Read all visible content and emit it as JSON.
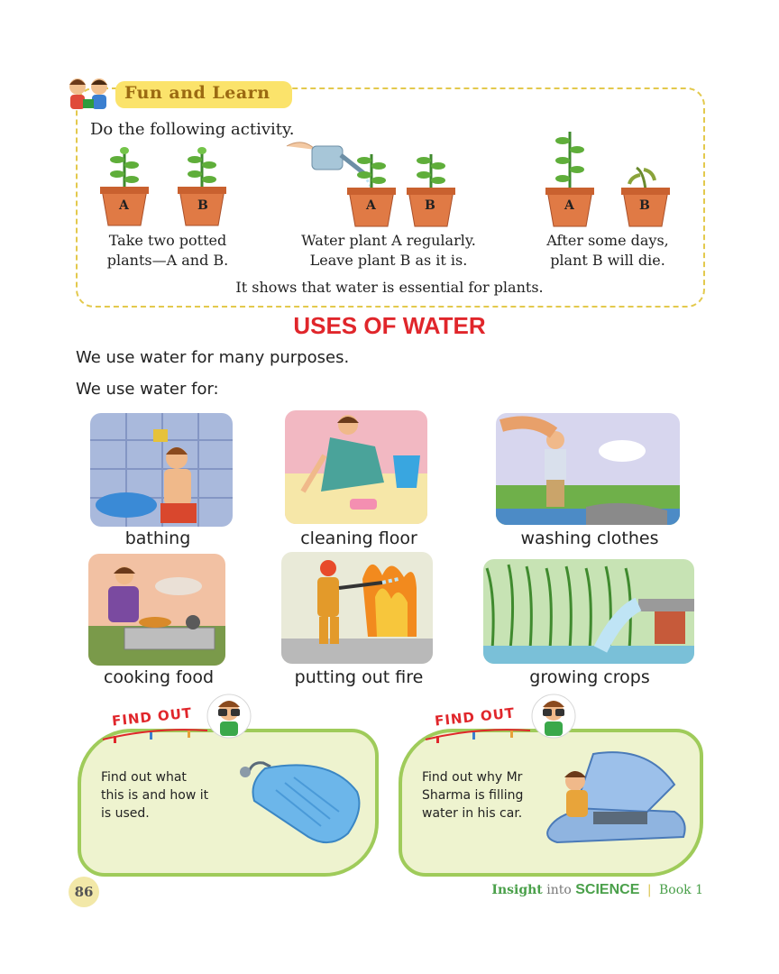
{
  "fun_and_learn": {
    "title": "Fun and Learn",
    "instruction": "Do the following activity.",
    "pot_labels": {
      "a": "A",
      "b": "B"
    },
    "steps": [
      {
        "line1": "Take two potted",
        "line2": "plants—A and B."
      },
      {
        "line1": "Water plant A regularly.",
        "line2": "Leave plant B as it is."
      },
      {
        "line1": "After some days,",
        "line2": "plant B will die."
      }
    ],
    "conclusion": "It shows that water is essential for plants."
  },
  "uses": {
    "title": "USES OF WATER",
    "intro1": "We use water for many purposes.",
    "intro2": "We use water for:",
    "items": [
      {
        "label": "bathing"
      },
      {
        "label": "cleaning floor"
      },
      {
        "label": "washing clothes"
      },
      {
        "label": "cooking food"
      },
      {
        "label": "putting out fire"
      },
      {
        "label": "growing crops"
      }
    ]
  },
  "find_out": {
    "title": "FIND OUT",
    "boxes": [
      {
        "line1": "Find out what",
        "line2": "this is and how it",
        "line3": "is used."
      },
      {
        "line1": "Find out why Mr",
        "line2": "Sharma is filling",
        "line3": "water in his car."
      }
    ]
  },
  "footer": {
    "page_number": "86",
    "brand_insight": "Insight",
    "brand_into": "into",
    "brand_science": "SCIENCE",
    "brand_book": "Book 1"
  }
}
